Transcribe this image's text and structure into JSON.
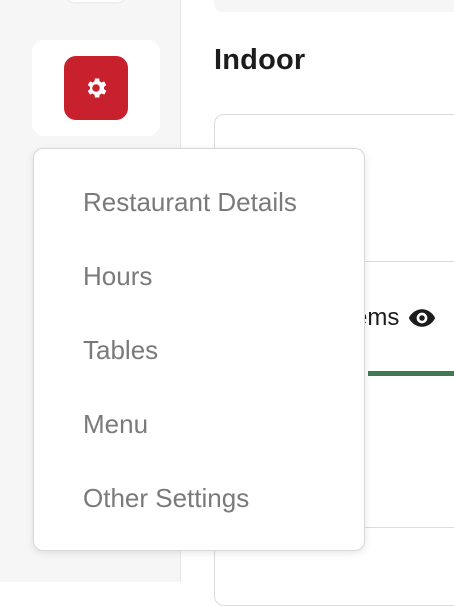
{
  "main": {
    "section_title": "Indoor",
    "card_tab_label": "ems"
  },
  "icons": {
    "settings": "gear-icon",
    "visibility": "eye-icon"
  },
  "colors": {
    "settings_button": "#c8202c",
    "tab_underline": "#3f7a55",
    "menu_text": "#7a7a7a"
  },
  "settings_menu": {
    "items": [
      {
        "label": "Restaurant Details"
      },
      {
        "label": "Hours"
      },
      {
        "label": "Tables"
      },
      {
        "label": "Menu"
      },
      {
        "label": "Other Settings"
      }
    ]
  }
}
